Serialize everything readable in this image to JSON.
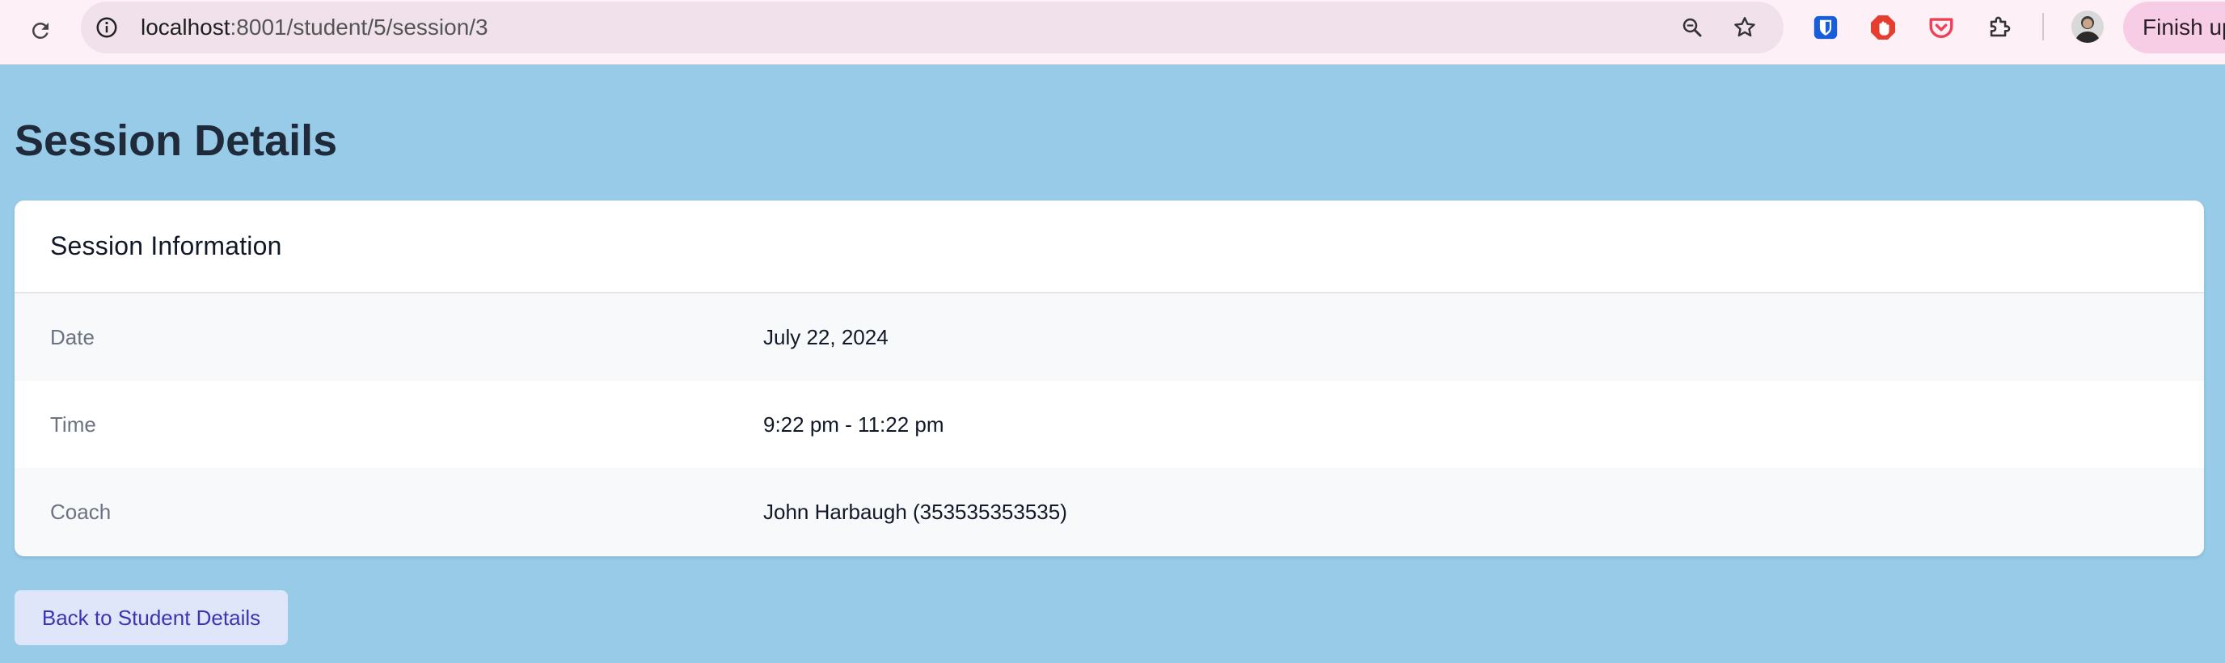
{
  "browser": {
    "url_host": "localhost",
    "url_path": ":8001/student/5/session/3",
    "finish_label": "Finish up",
    "extensions": [
      "bitwarden-icon",
      "adblock-icon",
      "pocket-icon",
      "puzzle-extensions-icon"
    ],
    "colors": {
      "bitwarden": "#175ddc",
      "adblock": "#e53e2f",
      "pocket": "#ef4056"
    }
  },
  "page": {
    "title": "Session Details",
    "background": "#97cbe8"
  },
  "card": {
    "title": "Session Information",
    "rows": [
      {
        "label": "Date",
        "value": "July 22, 2024"
      },
      {
        "label": "Time",
        "value": "9:22 pm - 11:22 pm"
      },
      {
        "label": "Coach",
        "value": "John Harbaugh (353535353535)"
      }
    ]
  },
  "actions": {
    "back_label": "Back to Student Details"
  }
}
